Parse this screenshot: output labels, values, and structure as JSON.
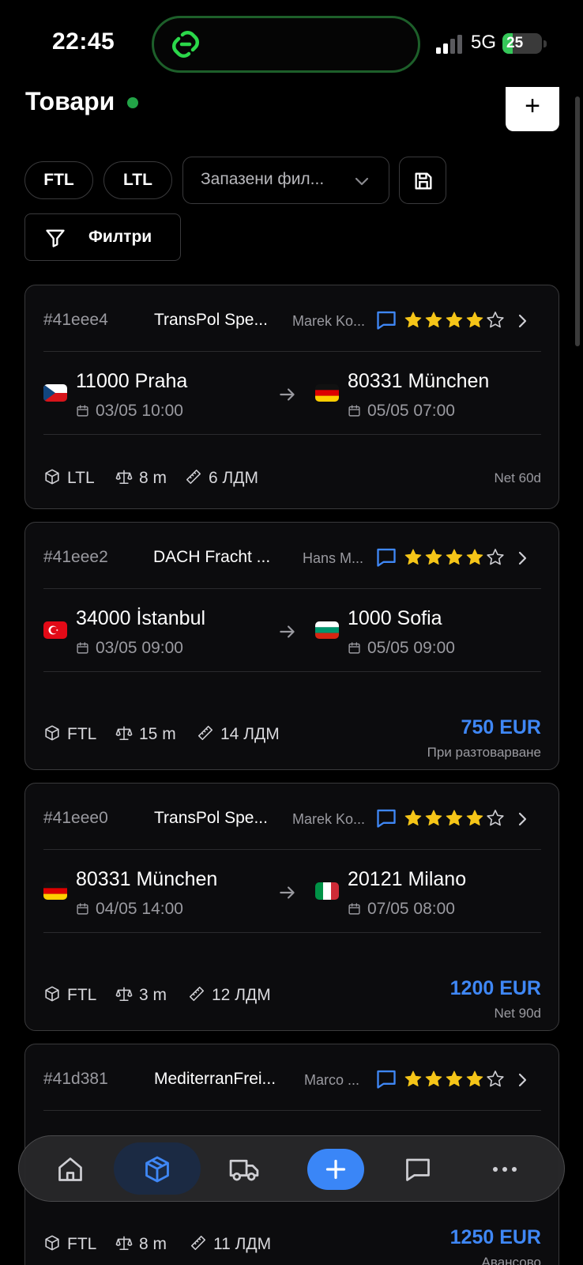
{
  "status_bar": {
    "time": "22:45",
    "network": "5G",
    "battery": "25",
    "battery_level": 0.25,
    "island_icon": "link-app-icon"
  },
  "header": {
    "title": "Товари",
    "online_color": "#22a447",
    "add_label": "+"
  },
  "filters": {
    "chips": [
      "FTL",
      "LTL"
    ],
    "saved_filters_placeholder": "Запазени фил...",
    "filters_label": "Филтри"
  },
  "colors": {
    "accent": "#3f87f5",
    "star": "#f5c518",
    "border": "#3a3a3c"
  },
  "cards": [
    {
      "id": "#41eee4",
      "company": "TransPol Spe...",
      "contact": "Marek Ko...",
      "rating": 4,
      "from_city": "11000 Praha",
      "from_date": "03/05 10:00",
      "from_flag": "CZ",
      "to_city": "80331 München",
      "to_date": "05/05 07:00",
      "to_flag": "DE",
      "type": "LTL",
      "weight": "8 m",
      "ldm": "6 ЛДМ",
      "price": "",
      "terms": "Net 60d"
    },
    {
      "id": "#41eee2",
      "company": "DACH Fracht ...",
      "contact": "Hans M...",
      "rating": 4,
      "from_city": "34000 İstanbul",
      "from_date": "03/05 09:00",
      "from_flag": "TR",
      "to_city": "1000 Sofia",
      "to_date": "05/05 09:00",
      "to_flag": "BG",
      "type": "FTL",
      "weight": "15 m",
      "ldm": "14 ЛДМ",
      "price": "750 EUR",
      "terms": "При разтоварване"
    },
    {
      "id": "#41eee0",
      "company": "TransPol Spe...",
      "contact": "Marek Ko...",
      "rating": 4,
      "from_city": "80331 München",
      "from_date": "04/05 14:00",
      "from_flag": "DE",
      "to_city": "20121 Milano",
      "to_date": "07/05 08:00",
      "to_flag": "IT",
      "type": "FTL",
      "weight": "3 m",
      "ldm": "12 ЛДМ",
      "price": "1200 EUR",
      "terms": "Net 90d"
    },
    {
      "id": "#41d381",
      "company": "MediterranFrei...",
      "contact": "Marco ...",
      "rating": 4,
      "type": "FTL",
      "weight": "8 m",
      "ldm": "11 ЛДМ",
      "price": "1250 EUR",
      "terms": "Авансово"
    }
  ],
  "tabbar": {
    "items": [
      "home-icon",
      "package-icon",
      "truck-icon",
      "plus-icon",
      "chat-icon",
      "more-icon"
    ],
    "active": "package-icon"
  }
}
